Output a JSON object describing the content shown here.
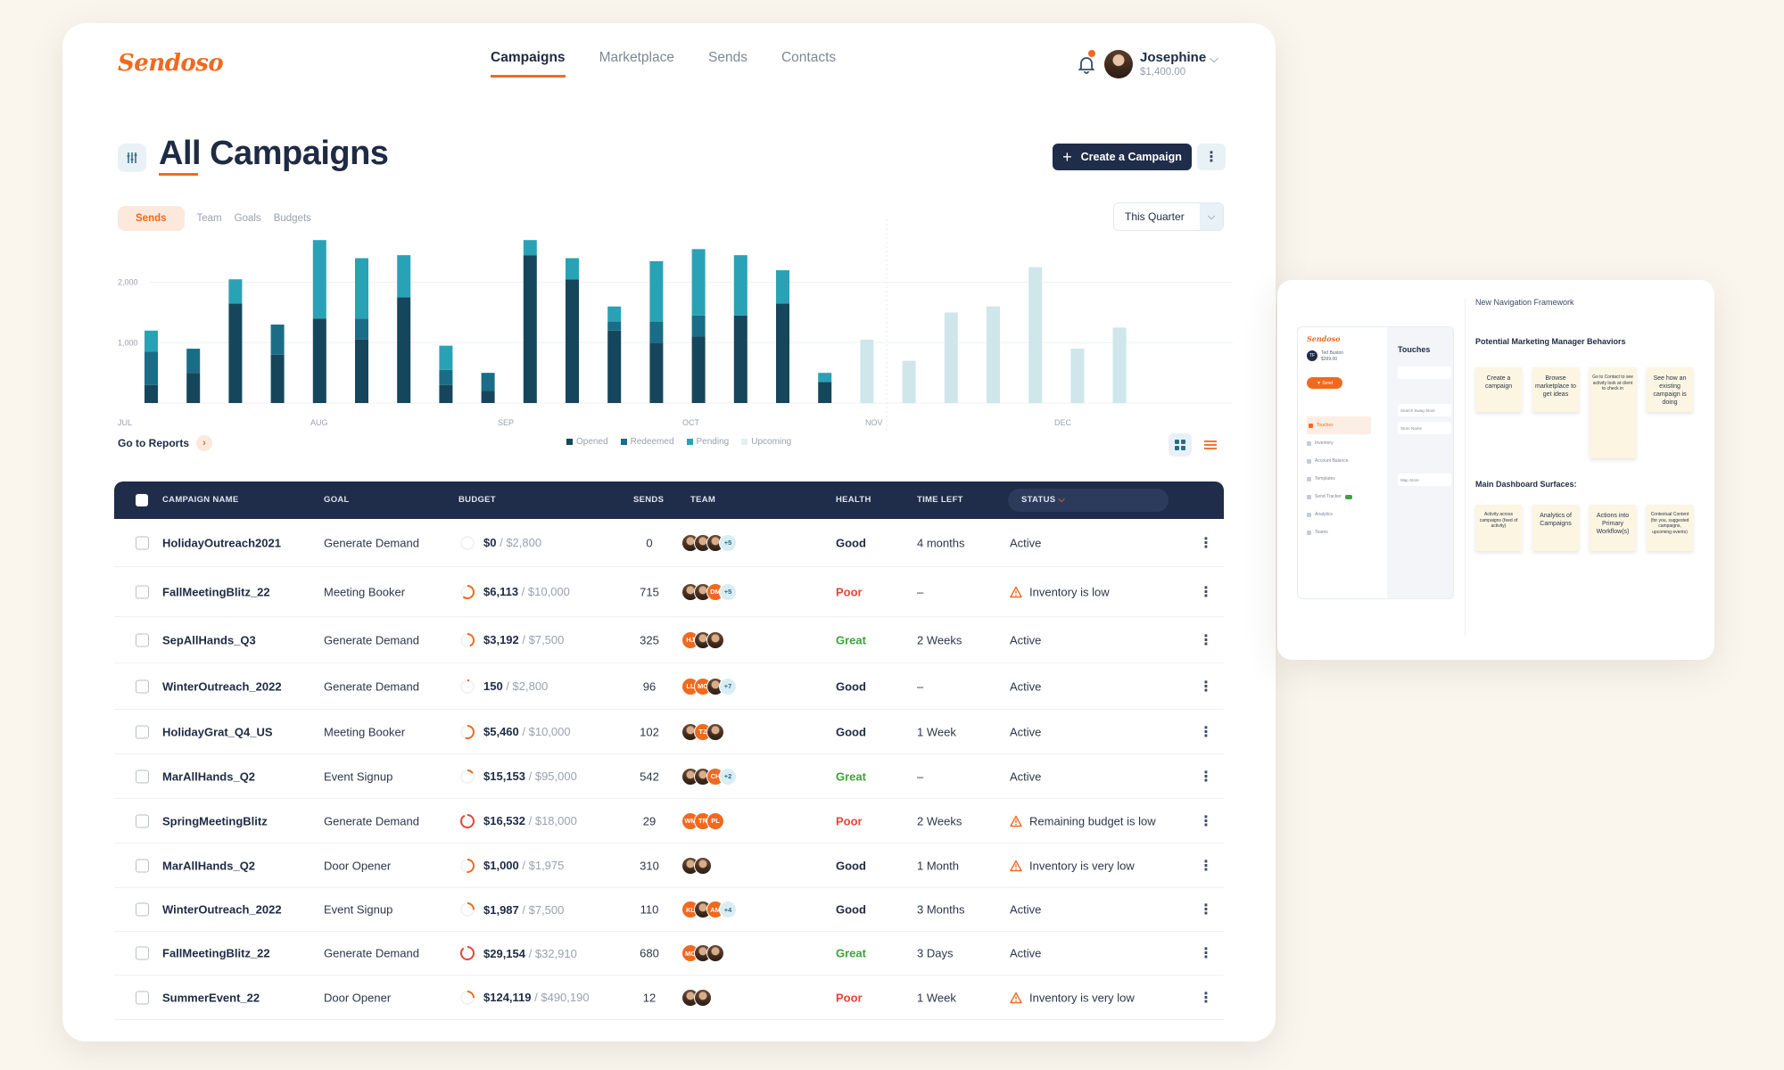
{
  "app": {
    "logo": "Sendoso",
    "nav": [
      "Campaigns",
      "Marketplace",
      "Sends",
      "Contacts"
    ],
    "active_nav": 0,
    "user": {
      "name": "Josephine",
      "balance": "$1,400.00"
    }
  },
  "page": {
    "title": "All Campaigns",
    "create_label": "Create a Campaign",
    "subtabs": [
      "Sends",
      "Team",
      "Goals",
      "Budgets"
    ],
    "period": "This Quarter",
    "goto_reports": "Go to Reports",
    "legend": [
      "Opened",
      "Redeemed",
      "Pending",
      "Upcoming"
    ]
  },
  "colors": {
    "accent": "#ef6a1f",
    "navy": "#1f2c4a",
    "opened": "#16465c",
    "redeemed": "#1a6d86",
    "pending": "#2aa2b5",
    "upcoming": "#cfe6ea",
    "great": "#3da33b",
    "poor": "#e0463c"
  },
  "chart_data": {
    "type": "bar",
    "stacked": true,
    "ylim": [
      0,
      2600
    ],
    "yticks": [
      "2,000",
      "1,000"
    ],
    "ytick_values": [
      2000,
      1000
    ],
    "x_month_labels": [
      "JUL",
      "AUG",
      "SEP",
      "OCT",
      "NOV",
      "DEC"
    ],
    "series": [
      {
        "name": "Opened",
        "values": [
          300,
          500,
          1650,
          800,
          1400,
          1050,
          1750,
          300,
          200,
          2450,
          2050,
          1200,
          1000,
          1100,
          1450,
          1650,
          350,
          0,
          0,
          0,
          0,
          0,
          0,
          0
        ]
      },
      {
        "name": "Redeemed",
        "values": [
          550,
          400,
          0,
          500,
          0,
          350,
          0,
          250,
          300,
          0,
          0,
          150,
          350,
          350,
          0,
          0,
          0,
          0,
          0,
          0,
          0,
          0,
          0,
          0
        ]
      },
      {
        "name": "Pending",
        "values": [
          350,
          0,
          400,
          0,
          1300,
          1000,
          700,
          400,
          0,
          250,
          350,
          250,
          1000,
          1100,
          1000,
          550,
          150,
          0,
          0,
          0,
          0,
          0,
          0,
          0
        ]
      },
      {
        "name": "Upcoming",
        "values": [
          0,
          0,
          0,
          0,
          0,
          0,
          0,
          0,
          0,
          0,
          0,
          0,
          0,
          0,
          0,
          0,
          0,
          1050,
          700,
          1500,
          1600,
          2250,
          900,
          1250
        ]
      }
    ]
  },
  "table": {
    "headers": [
      "CAMPAIGN NAME",
      "GOAL",
      "BUDGET",
      "SENDS",
      "TEAM",
      "HEALTH",
      "TIME LEFT",
      "STATUS"
    ],
    "rows": [
      {
        "name": "HolidayOutreach2021",
        "goal": "Generate Demand",
        "spent": "$0",
        "total": "/ $2,800",
        "pct": 0,
        "sends": "0",
        "team": [
          {
            "t": "photo"
          },
          {
            "t": "photo"
          },
          {
            "t": "photo"
          },
          {
            "t": "more",
            "l": "+5"
          }
        ],
        "health": "Good",
        "time": "4 months",
        "status": "Active",
        "warn": false
      },
      {
        "name": "FallMeetingBlitz_22",
        "goal": "Meeting Booker",
        "spent": "$6,113",
        "total": "/ $10,000",
        "pct": 0.61,
        "sends": "715",
        "team": [
          {
            "t": "photo"
          },
          {
            "t": "photo"
          },
          {
            "t": "orange",
            "l": "DM"
          },
          {
            "t": "more",
            "l": "+5"
          }
        ],
        "health": "Poor",
        "time": "–",
        "status": "Inventory is low",
        "warn": true
      },
      {
        "name": "SepAllHands_Q3",
        "goal": "Generate Demand",
        "spent": "$3,192",
        "total": "/ $7,500",
        "pct": 0.43,
        "sends": "325",
        "team": [
          {
            "t": "orange",
            "l": "HJ"
          },
          {
            "t": "photo"
          },
          {
            "t": "photo"
          }
        ],
        "health": "Great",
        "time": "2 Weeks",
        "status": "Active",
        "warn": false
      },
      {
        "name": "WinterOutreach_2022",
        "goal": "Generate Demand",
        "spent": "150",
        "total": "/ $2,800",
        "pct": 0.05,
        "sends": "96",
        "team": [
          {
            "t": "orange",
            "l": "LL"
          },
          {
            "t": "orange",
            "l": "MO"
          },
          {
            "t": "photo"
          },
          {
            "t": "more",
            "l": "+7"
          }
        ],
        "health": "Good",
        "time": "–",
        "status": "Active",
        "warn": false
      },
      {
        "name": "HolidayGrat_Q4_US",
        "goal": "Meeting Booker",
        "spent": "$5,460",
        "total": "/ $10,000",
        "pct": 0.55,
        "sends": "102",
        "team": [
          {
            "t": "photo"
          },
          {
            "t": "orange",
            "l": "TZ"
          },
          {
            "t": "photo"
          }
        ],
        "health": "Good",
        "time": "1 Week",
        "status": "Active",
        "warn": false
      },
      {
        "name": "MarAllHands_Q2",
        "goal": "Event Signup",
        "spent": "$15,153",
        "total": "/ $95,000",
        "pct": 0.16,
        "sends": "542",
        "team": [
          {
            "t": "photo"
          },
          {
            "t": "photo"
          },
          {
            "t": "orange",
            "l": "CH"
          },
          {
            "t": "more",
            "l": "+2"
          }
        ],
        "health": "Great",
        "time": "–",
        "status": "Active",
        "warn": false
      },
      {
        "name": "SpringMeetingBlitz",
        "goal": "Generate Demand",
        "spent": "$16,532",
        "total": "/ $18,000",
        "pct": 0.92,
        "sends": "29",
        "team": [
          {
            "t": "orange",
            "l": "WM"
          },
          {
            "t": "orange",
            "l": "TR"
          },
          {
            "t": "orange",
            "l": "PL"
          }
        ],
        "health": "Poor",
        "time": "2 Weeks",
        "status": "Remaining budget is low",
        "warn": true
      },
      {
        "name": "MarAllHands_Q2",
        "goal": "Door Opener",
        "spent": "$1,000",
        "total": "/ $1,975",
        "pct": 0.51,
        "sends": "310",
        "team": [
          {
            "t": "photo"
          },
          {
            "t": "photo"
          }
        ],
        "health": "Good",
        "time": "1 Month",
        "status": "Inventory is very low",
        "warn": true
      },
      {
        "name": "WinterOutreach_2022",
        "goal": "Event Signup",
        "spent": "$1,987",
        "total": "/ $7,500",
        "pct": 0.26,
        "sends": "110",
        "team": [
          {
            "t": "orange",
            "l": "KL"
          },
          {
            "t": "photo"
          },
          {
            "t": "orange",
            "l": "AM"
          },
          {
            "t": "more",
            "l": "+4"
          }
        ],
        "health": "Good",
        "time": "3 Months",
        "status": "Active",
        "warn": false
      },
      {
        "name": "FallMeetingBlitz_22",
        "goal": "Generate Demand",
        "spent": "$29,154",
        "total": "/ $32,910",
        "pct": 0.89,
        "sends": "680",
        "team": [
          {
            "t": "orange",
            "l": "MO"
          },
          {
            "t": "photo"
          },
          {
            "t": "photo"
          }
        ],
        "health": "Great",
        "time": "3 Days",
        "status": "Active",
        "warn": false
      },
      {
        "name": "SummerEvent_22",
        "goal": "Door Opener",
        "spent": "$124,119",
        "total": "/ $490,190",
        "pct": 0.25,
        "sends": "12",
        "team": [
          {
            "t": "photo"
          },
          {
            "t": "photo"
          }
        ],
        "health": "Poor",
        "time": "1 Week",
        "status": "Inventory is very low",
        "warn": true
      }
    ]
  },
  "side": {
    "title": "New Navigation Framework",
    "behaviors_title": "Potential Marketing Manager Behaviors",
    "behaviors": [
      "Create a campaign",
      "Browse marketplace to get ideas",
      "Go to Contact to see activity look at client to check in",
      "See how an existing campaign is doing"
    ],
    "surfaces_title": "Main Dashboard Surfaces:",
    "surfaces": [
      "Activity across campaigns (feed of activity)",
      "Analytics of Campaigns",
      "Actions into Primary Workflow(s)",
      "Contextual Content (for you, suggested campaigns, upcoming events)"
    ],
    "mini": {
      "logo": "Sendoso",
      "initials": "TF",
      "user_name": "Ted Buston",
      "user_balance": "$399.00",
      "send": "Send",
      "nav": [
        "Touches",
        "Inventory",
        "Account Balance",
        "Templates",
        "Send Tracker",
        "Analytics",
        "Teams"
      ],
      "panel_title": "Touches",
      "panel_boxes": [
        "Search Swag Store",
        "Store Name",
        "Map Store"
      ]
    }
  }
}
